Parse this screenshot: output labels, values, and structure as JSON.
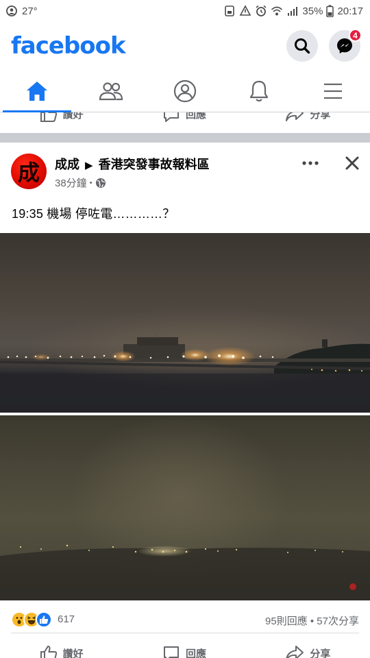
{
  "status_bar": {
    "temperature": "27°",
    "battery": "35%",
    "time": "20:17"
  },
  "header": {
    "logo": "facebook",
    "messenger_badge": "4"
  },
  "prev_post_actions": {
    "like_label": "讚好",
    "comment_label": "回應",
    "share_label": "分享"
  },
  "post": {
    "author": "成成",
    "group": "香港突發事故報料區",
    "timestamp": "38分鐘",
    "separator": "•",
    "avatar_char": "成",
    "text": "19:35 機場 停咗電…………？",
    "reaction_count": "617",
    "comment_share": "95則回應 • 57次分享",
    "actions": {
      "like_label": "讚好",
      "comment_label": "回應",
      "share_label": "分享"
    }
  },
  "colors": {
    "brand": "#1877f2",
    "badge": "#e41e3f",
    "icon_gray": "#65676b"
  }
}
